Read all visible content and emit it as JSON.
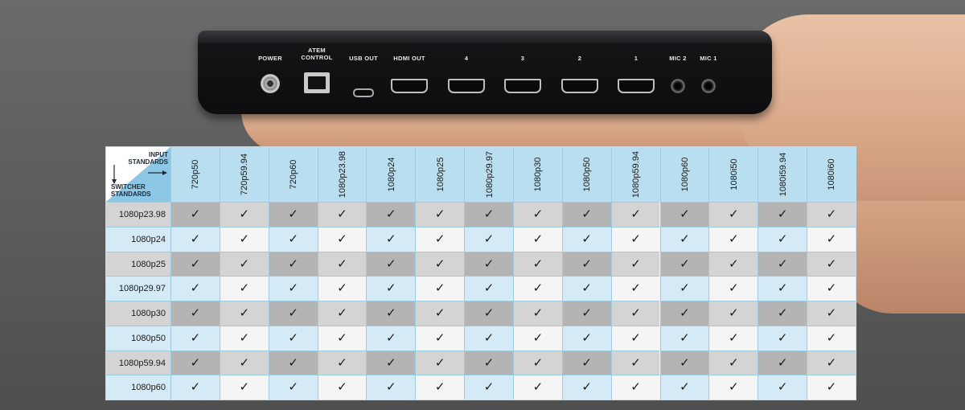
{
  "device": {
    "ports": [
      {
        "label": "POWER",
        "kind": "bnc-icon"
      },
      {
        "label": "ATEM\nCONTROL",
        "kind": "rj45-icon"
      },
      {
        "label": "USB OUT",
        "kind": "usb-c-icon"
      },
      {
        "label": "HDMI OUT",
        "kind": "hdmi-icon"
      },
      {
        "label": "4",
        "kind": "hdmi-icon"
      },
      {
        "label": "3",
        "kind": "hdmi-icon"
      },
      {
        "label": "2",
        "kind": "hdmi-icon"
      },
      {
        "label": "1",
        "kind": "hdmi-icon"
      },
      {
        "label": "MIC 2",
        "kind": "audio-jack-icon"
      },
      {
        "label": "MIC 1",
        "kind": "audio-jack-icon"
      }
    ]
  },
  "table": {
    "corner_top": "INPUT\nSTANDARDS",
    "corner_bottom": "SWITCHER\nSTANDARDS",
    "columns": [
      "720p50",
      "720p59.94",
      "720p60",
      "1080p23.98",
      "1080p24",
      "1080p25",
      "1080p29.97",
      "1080p30",
      "1080p50",
      "1080p59.94",
      "1080p60",
      "1080i50",
      "1080i59.94",
      "1080i60"
    ],
    "rows": [
      "1080p23.98",
      "1080p24",
      "1080p25",
      "1080p29.97",
      "1080p30",
      "1080p50",
      "1080p59.94",
      "1080p60"
    ],
    "check_symbol": "✓",
    "colors": {
      "header_blue": "#b9def0",
      "corner_blue": "#8cc8e6",
      "cell_blue": "#d4ebf7",
      "cell_grey": "#d4d4d4",
      "cell_grey_dark": "#b4b4b4",
      "cell_white": "#f5f5f5"
    }
  }
}
